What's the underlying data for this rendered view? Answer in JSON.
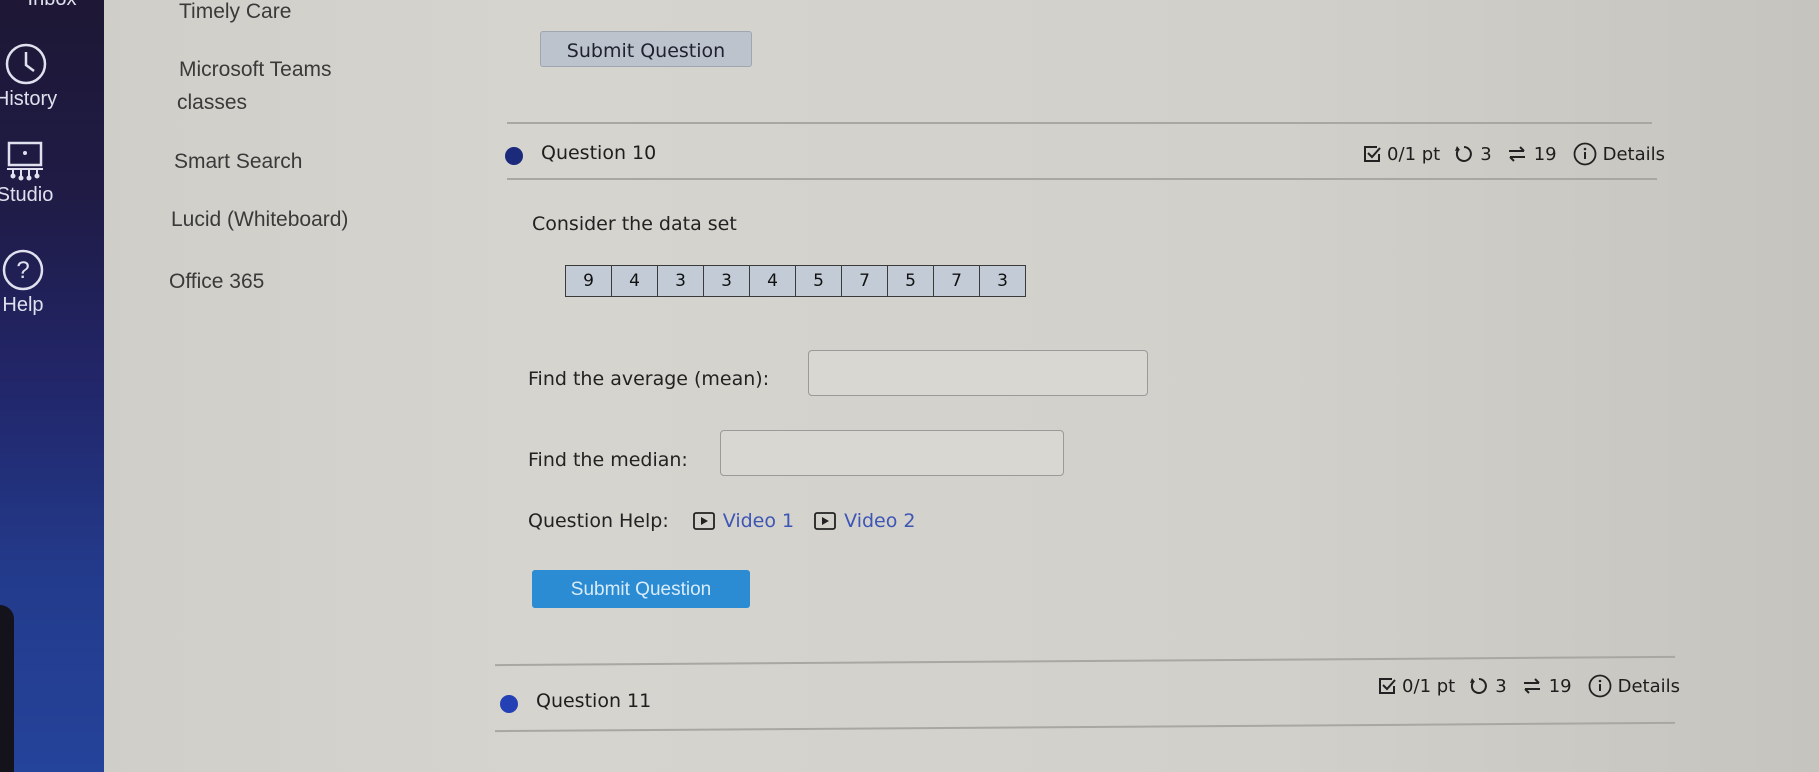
{
  "global_nav": {
    "items": [
      {
        "label": "Inbox",
        "icon": "inbox-icon"
      },
      {
        "label": "History",
        "icon": "clock-icon"
      },
      {
        "label": "Studio",
        "icon": "studio-icon"
      },
      {
        "label": "Help",
        "icon": "help-icon"
      }
    ]
  },
  "tray_menu": {
    "links": [
      "Timely Care",
      "Microsoft Teams",
      "classes",
      "Smart Search",
      "Lucid (Whiteboard)",
      "Office 365"
    ]
  },
  "previous_question": {
    "submit_label": "Submit Question"
  },
  "question10": {
    "title": "Question 10",
    "points": "0/1 pt",
    "retries": "3",
    "versions": "19",
    "details_label": "Details",
    "prompt": "Consider the data set",
    "dataset": [
      "9",
      "4",
      "3",
      "3",
      "4",
      "5",
      "7",
      "5",
      "7",
      "3"
    ],
    "mean_label": "Find the average (mean):",
    "mean_value": "",
    "median_label": "Find the median:",
    "median_value": "",
    "help_label": "Question Help:",
    "videos": [
      "Video 1",
      "Video 2"
    ],
    "submit_label": "Submit Question"
  },
  "question11": {
    "title": "Question 11",
    "points": "0/1 pt",
    "retries": "3",
    "versions": "19",
    "details_label": "Details"
  },
  "colors": {
    "bullet": "#1b2a7a",
    "submit_primary": "#2b8bd3",
    "link": "#3d55b5",
    "sidebar_top": "#1e1735",
    "sidebar_bottom": "#24439a"
  }
}
